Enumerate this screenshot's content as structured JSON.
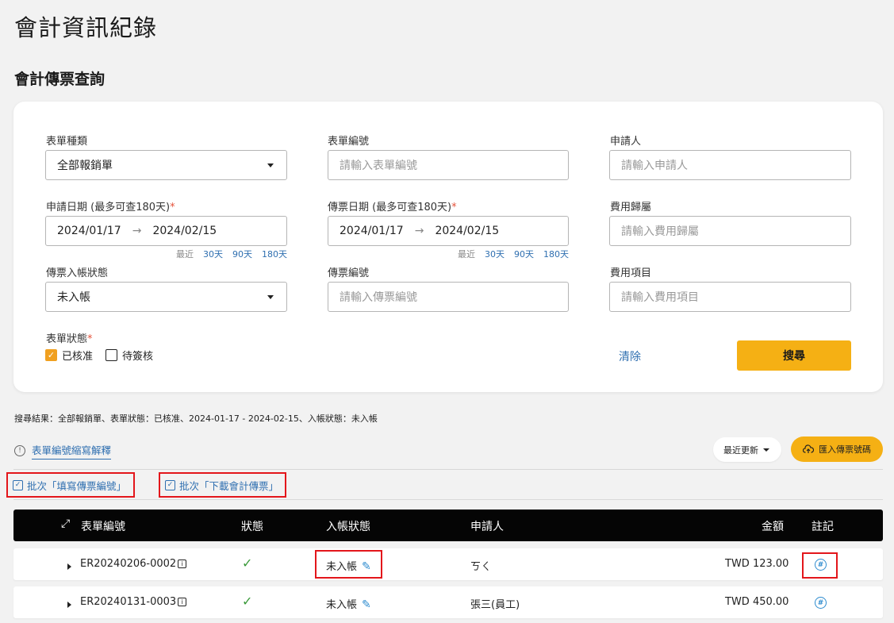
{
  "page_title": "會計資訊紀錄",
  "section_title": "會計傳票查詢",
  "form": {
    "form_type": {
      "label": "表單種類",
      "value": "全部報銷單"
    },
    "form_no": {
      "label": "表單編號",
      "placeholder": "請輸入表單編號"
    },
    "applicant": {
      "label": "申請人",
      "placeholder": "請輸入申請人"
    },
    "apply_date": {
      "label": "申請日期 (最多可查180天)",
      "required": "*",
      "from": "2024/01/17",
      "to": "2024/02/15"
    },
    "voucher_date": {
      "label": "傳票日期 (最多可查180天)",
      "required": "*",
      "from": "2024/01/17",
      "to": "2024/02/15"
    },
    "expense_owner": {
      "label": "費用歸屬",
      "placeholder": "請輸入費用歸屬"
    },
    "quick_ranges": {
      "label": "最近",
      "opt1": "30天",
      "opt2": "90天",
      "opt3": "180天"
    },
    "posting_status": {
      "label": "傳票入帳狀態",
      "value": "未入帳"
    },
    "voucher_no": {
      "label": "傳票編號",
      "placeholder": "請輸入傳票編號"
    },
    "expense_item": {
      "label": "費用項目",
      "placeholder": "請輸入費用項目"
    },
    "form_status": {
      "label": "表單狀態",
      "required": "*",
      "opt_approved": "已核准",
      "opt_pending": "待簽核",
      "approved_checked": true,
      "pending_checked": false
    },
    "clear_label": "清除",
    "search_label": "搜尋"
  },
  "summary_text": "搜尋結果：全部報銷單、表單狀態：已核准、2024-01-17 - 2024-02-15、入帳狀態：未入帳",
  "explain_link": "表單編號縮寫解釋",
  "sort_label": "最近更新",
  "import_label": "匯入傳票號碼",
  "batch_fill": "批次「填寫傳票編號」",
  "batch_download": "批次「下載會計傳票」",
  "table": {
    "headers": {
      "form_no": "表單編號",
      "status": "狀態",
      "posting": "入帳狀態",
      "applicant": "申請人",
      "amount": "金額",
      "note": "註記"
    },
    "rows": [
      {
        "form_no": "ER20240206-0002",
        "posting": "未入帳",
        "applicant": "ㄎㄑ",
        "amount": "TWD 123.00"
      },
      {
        "form_no": "ER20240131-0003",
        "posting": "未入帳",
        "applicant": "張三(員工)",
        "amount": "TWD 450.00"
      }
    ]
  },
  "icons": {
    "expand": "expand-arrows-icon",
    "check": "check-icon",
    "edit": "edit-icon",
    "note": "note-icon",
    "info": "info-circle-icon",
    "upload": "cloud-upload-icon"
  },
  "colors": {
    "accent": "#f5b014",
    "link": "#2f6fb0",
    "highlight": "#e3161b"
  }
}
